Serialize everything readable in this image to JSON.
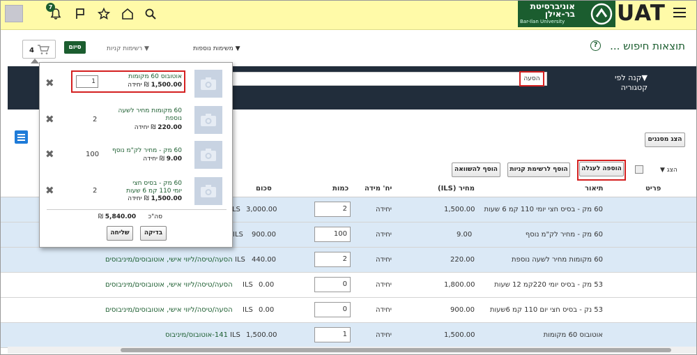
{
  "topbar": {
    "notifications_count": "7",
    "logo_line1": "אוניברסיטת",
    "logo_line2": "בר-אילן",
    "logo_eng": "Bar-Ilan University",
    "env_label": "UAT"
  },
  "header": {
    "title": "תוצאות חיפוש ...",
    "menu_more_lists": "משימות נוספות",
    "menu_shopping_lists": "רשימות קניות",
    "done_label": "סיום",
    "cart_count": "4"
  },
  "search": {
    "value": "הסעה",
    "buy_by_category": "קנה לפי קטגוריה"
  },
  "toolbar": {
    "filters_label": "הצג מסננים",
    "view_label": "הצג",
    "add_to_cart": "הוספה לעגלה",
    "add_to_shopping_list": "הוסף לרשימת קניות",
    "add_to_compare": "הוסף להשוואה"
  },
  "table": {
    "headers": {
      "item": "פריט",
      "description": "תיאור",
      "price": "מחיר (ILS)",
      "unit": "יח' מידה",
      "quantity": "כמות",
      "amount": "סכום"
    },
    "rows": [
      {
        "description": "60 מק - בסיס חצי יומי 110 קמ 6 שעות",
        "price": "1,500.00",
        "unit": "יחידה",
        "qty": "2",
        "amount": "3,000.00",
        "currency": "ILS",
        "supplier": ""
      },
      {
        "description": "60 מק - מחיר לק\"מ נוסף",
        "price": "9.00",
        "unit": "יחידה",
        "qty": "100",
        "amount": "900.00",
        "currency": "ILS",
        "supplier": ""
      },
      {
        "description": "60 מקומות מחיר לשעה נוספת",
        "price": "220.00",
        "unit": "יחידה",
        "qty": "2",
        "amount": "440.00",
        "currency": "ILS",
        "supplier": "הסעה/טיסה/ליווי אישי, אוטובוסים/מיניבוסים"
      },
      {
        "description": "53 מק - בסיס יומי 220קמ 12 שעות",
        "price": "1,800.00",
        "unit": "יחידה",
        "qty": "0",
        "amount": "0.00",
        "currency": "ILS",
        "supplier": "הסעה/טיסה/ליווי אישי, אוטובוסים/מיניבוסים"
      },
      {
        "description": "53 נק - בסיס חצי יום 110 קמ 6שעות",
        "price": "900.00",
        "unit": "יחידה",
        "qty": "0",
        "amount": "0.00",
        "currency": "ILS",
        "supplier": "הסעה/טיסה/ליווי אישי, אוטובוסים/מיניבוסים"
      },
      {
        "description": "אוטובוס 60 מקומות",
        "price": "1,500.00",
        "unit": "יחידה",
        "qty": "1",
        "amount": "1,500.00",
        "currency": "ILS",
        "supplier": "141-אוטובוס/מיניבוס"
      }
    ]
  },
  "cart_popover": {
    "items": [
      {
        "name": "אוטובוס 60 מקומות",
        "price": "1,500.00",
        "unit_text": "₪ יחידה",
        "qty": "1"
      },
      {
        "name": "60 מקומות מחיר לשעה נוספת",
        "price": "220.00",
        "unit_text": "₪ יחידה",
        "qty": "2"
      },
      {
        "name": "60 מק - מחיר לק\"מ נוסף",
        "price": "9.00",
        "unit_text": "₪ יחידה",
        "qty": "100"
      },
      {
        "name": "60 מק - בסיס חצי יומי 110 קמ 6 שעות",
        "price": "1,500.00",
        "unit_text": "₪ יחידה",
        "qty": "2"
      }
    ],
    "total_label": "סה\"כ",
    "total_value": "5,840.00",
    "total_currency": "₪",
    "check_label": "בדיקה",
    "send_label": "שליחה"
  }
}
